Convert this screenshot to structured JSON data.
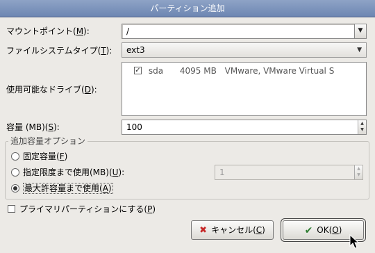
{
  "window": {
    "title": "パーティション追加"
  },
  "mount_point": {
    "label_prefix": "マウントポイント(",
    "label_key": "M",
    "label_suffix": "):",
    "value": "/"
  },
  "fs_type": {
    "label_prefix": "ファイルシステムタイプ(",
    "label_key": "T",
    "label_suffix": "):",
    "value": "ext3"
  },
  "drives": {
    "label_prefix": "使用可能なドライブ(",
    "label_key": "D",
    "label_suffix": "):",
    "rows": [
      {
        "checked": true,
        "name": "sda",
        "size": "4095 MB",
        "model": "VMware, VMware Virtual S"
      }
    ]
  },
  "size": {
    "label_prefix": "容量 (MB)(",
    "label_key": "S",
    "label_suffix": "):",
    "value": "100"
  },
  "options": {
    "group_label": "追加容量オプション",
    "fixed": {
      "prefix": "固定容量(",
      "key": "F",
      "suffix": ")",
      "selected": false
    },
    "limit": {
      "prefix": "指定限度まで使用(MB)(",
      "key": "U",
      "suffix": "):",
      "selected": false,
      "value": "1"
    },
    "max": {
      "prefix": "最大許容量まで使用(",
      "key": "A",
      "suffix": ")",
      "selected": true
    }
  },
  "primary": {
    "prefix": "プライマリパーティションにする(",
    "key": "P",
    "suffix": ")",
    "checked": false
  },
  "buttons": {
    "cancel": {
      "prefix": "キャンセル(",
      "key": "C",
      "suffix": ")"
    },
    "ok": {
      "prefix": "OK(",
      "key": "O",
      "suffix": ")"
    }
  },
  "icons": {
    "cancel": "cross-icon",
    "ok": "checkmark-icon",
    "dropdown": "triangle-down-icon",
    "cursor": "mouse-pointer-icon"
  },
  "colors": {
    "titlebar": "#7a91bb",
    "cancel_icon": "#c62828",
    "ok_icon": "#2e7d32"
  }
}
